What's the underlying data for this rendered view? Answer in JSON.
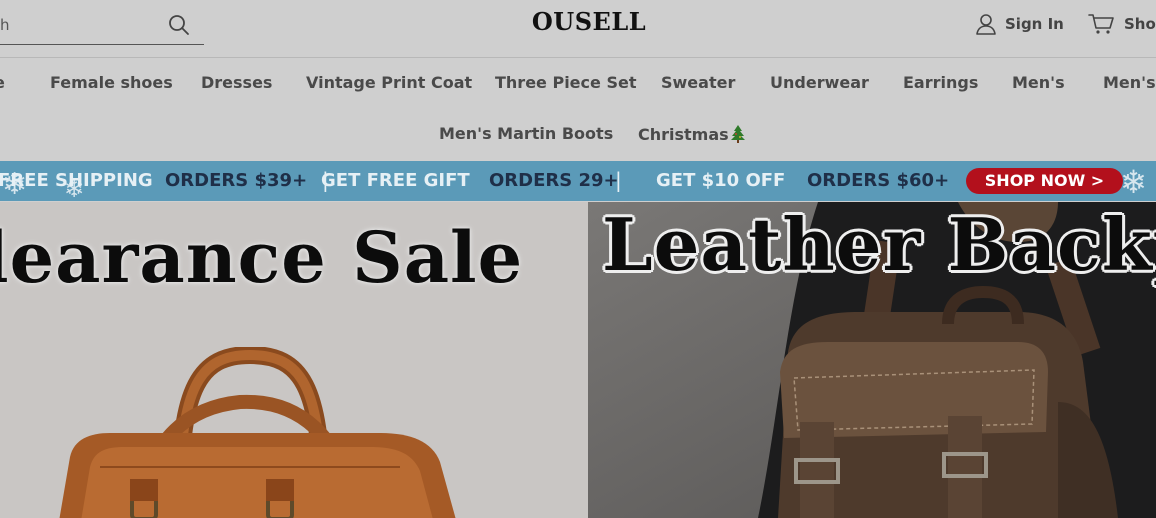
{
  "header": {
    "search_placeholder": "Search",
    "search_icon": "search-icon",
    "logo": "OUSELL",
    "signin_label": "Sign In",
    "signin_icon": "user-icon",
    "cart_label": "Shop",
    "cart_icon": "cart-icon"
  },
  "nav": {
    "row1": [
      "e",
      "Female shoes",
      "Dresses",
      "Vintage Print Coat",
      "Three Piece Set",
      "Sweater",
      "Underwear",
      "Earrings",
      "Men's",
      "Men's"
    ],
    "row2": [
      "Men's Martin Boots",
      "Christmas"
    ],
    "christmas_icon": "christmas-tree-icon"
  },
  "promo": {
    "free_shipping": "FREE SHIPPING",
    "orders_39": "ORDERS $39+",
    "free_gift": "GET FREE GIFT",
    "orders_29": "ORDERS 29+",
    "get_10_off": "GET $10 OFF",
    "orders_60": "ORDERS $60+",
    "separator": "|",
    "shop_now": "SHOP NOW >",
    "colors": {
      "background": "#5b9ab8",
      "light_text": "#e6f0f5",
      "dark_text": "#1f2f48",
      "button": "#b3101c"
    }
  },
  "hero": {
    "left_title": "learance Sale",
    "right_title": "Leather Backpa"
  }
}
